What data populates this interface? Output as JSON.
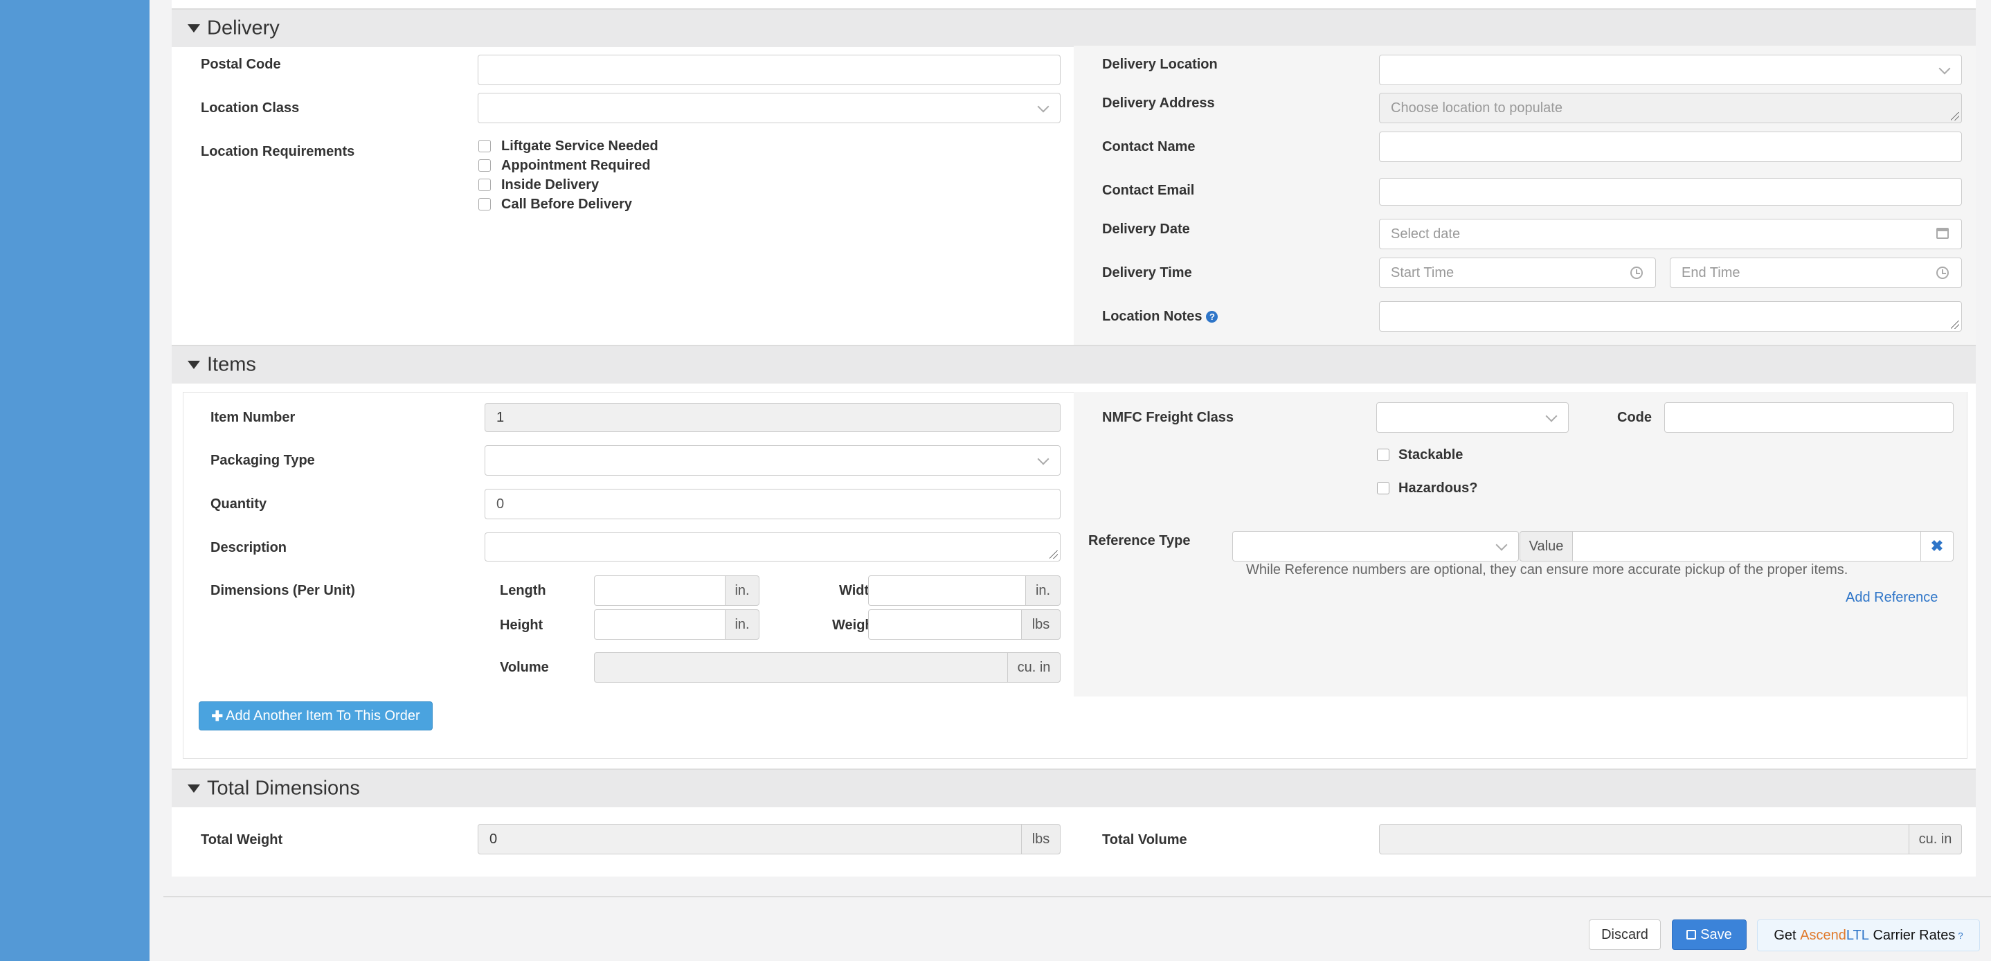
{
  "delivery": {
    "title": "Delivery",
    "postal_code_label": "Postal Code",
    "location_class_label": "Location Class",
    "location_requirements_label": "Location Requirements",
    "requirements": [
      "Liftgate Service Needed",
      "Appointment Required",
      "Inside Delivery",
      "Call Before Delivery"
    ],
    "delivery_location_label": "Delivery Location",
    "delivery_address_label": "Delivery Address",
    "delivery_address_placeholder": "Choose location to populate",
    "contact_name_label": "Contact Name",
    "contact_email_label": "Contact Email",
    "delivery_date_label": "Delivery Date",
    "delivery_date_placeholder": "Select date",
    "delivery_time_label": "Delivery Time",
    "start_time_placeholder": "Start Time",
    "end_time_placeholder": "End Time",
    "location_notes_label": "Location Notes"
  },
  "items": {
    "title": "Items",
    "item_number_label": "Item Number",
    "item_number_value": "1",
    "packaging_type_label": "Packaging Type",
    "quantity_label": "Quantity",
    "quantity_value": "0",
    "description_label": "Description",
    "dimensions_label": "Dimensions (Per Unit)",
    "length_label": "Length",
    "width_label": "Width",
    "height_label": "Height",
    "weight_label": "Weight",
    "volume_label": "Volume",
    "unit_in": "in.",
    "unit_lbs": "lbs",
    "unit_cuin": "cu. in",
    "nmfc_label": "NMFC Freight Class",
    "code_label": "Code",
    "stackable_label": "Stackable",
    "hazardous_label": "Hazardous?",
    "reference_type_label": "Reference Type",
    "value_label": "Value",
    "reference_hint": "While Reference numbers are optional, they can ensure more accurate pickup of the proper items.",
    "add_reference_label": "Add Reference",
    "add_item_label": "Add Another Item To This Order"
  },
  "totals": {
    "title": "Total Dimensions",
    "total_weight_label": "Total Weight",
    "total_weight_value": "0",
    "total_volume_label": "Total Volume",
    "unit_lbs": "lbs",
    "unit_cuin": "cu. in"
  },
  "footer": {
    "discard_label": "Discard",
    "save_label": "Save",
    "rates_get": "Get",
    "rates_ascend": "Ascend",
    "rates_ltl": "LTL",
    "rates_suffix": "Carrier Rates"
  },
  "colors": {
    "primary": "#3b83d9",
    "accent_orange": "#e07a2c",
    "link": "#2e75c8",
    "sidebar": "#5499d6"
  },
  "icons": {
    "collapse": "caret-down-icon",
    "plus": "plus-icon",
    "save": "floppy-disk-icon",
    "remove": "times-icon",
    "help": "question-circle-icon",
    "calendar": "calendar-icon",
    "clock": "clock-icon"
  }
}
